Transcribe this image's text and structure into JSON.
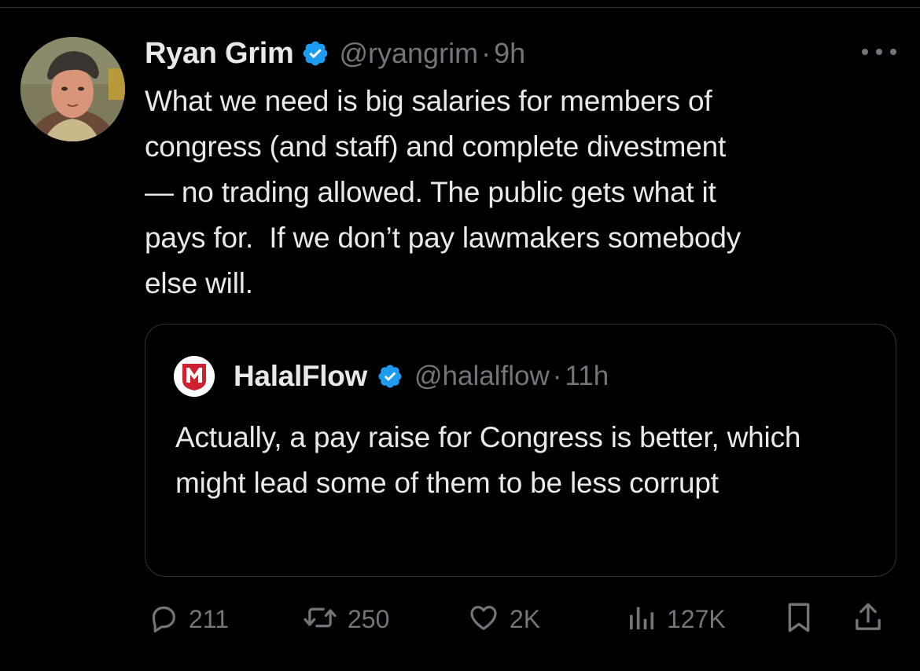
{
  "post": {
    "author_name": "Ryan Grim",
    "handle": "@ryangrim",
    "separator": "·",
    "time": "9h",
    "text": "What we need is big salaries for members of\ncongress (and staff) and complete divestment\n— no trading allowed. The public gets what it\npays for.  If we don’t pay lawmakers somebody\nelse will."
  },
  "quote": {
    "author_name": "HalalFlow",
    "handle": "@halalflow",
    "separator": "·",
    "time": "11h",
    "text": "Actually, a pay raise for Congress is better, which might lead some of them to be less corrupt"
  },
  "actions": {
    "replies": "211",
    "retweets": "250",
    "likes": "2K",
    "views": "127K"
  },
  "icons": {
    "verified": "verified-badge-icon",
    "more": "more-icon",
    "reply": "reply-icon",
    "retweet": "retweet-icon",
    "like": "heart-icon",
    "views": "views-icon",
    "bookmark": "bookmark-icon",
    "share": "share-icon"
  },
  "colors": {
    "background": "#000000",
    "text": "#e7e9ea",
    "secondary": "#71767b",
    "verified": "#1d9bf0",
    "border": "#2f3336",
    "halalflow_logo": "#d0202e"
  }
}
